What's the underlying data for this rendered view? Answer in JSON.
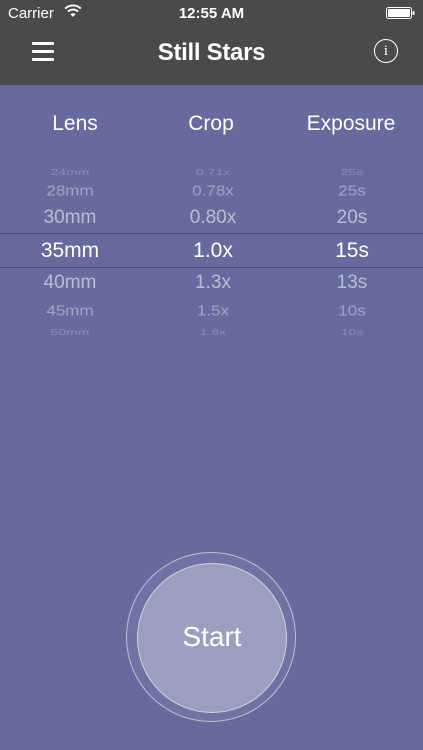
{
  "status_bar": {
    "carrier": "Carrier",
    "time": "12:55 AM",
    "wifi_icon": "wifi-icon",
    "battery_icon": "battery-icon"
  },
  "nav": {
    "title": "Still Stars",
    "menu_icon": "hamburger-menu-icon",
    "info_label": "i"
  },
  "columns": {
    "lens": "Lens",
    "crop": "Crop",
    "exposure": "Exposure"
  },
  "picker": {
    "lens": [
      "24mm",
      "28mm",
      "30mm",
      "35mm",
      "40mm",
      "45mm",
      "50mm"
    ],
    "crop": [
      "0.71x",
      "0.78x",
      "0.80x",
      "1.0x",
      "1.3x",
      "1.5x",
      "1.6x"
    ],
    "exposure": [
      "25s",
      "25s",
      "20s",
      "15s",
      "13s",
      "10s",
      "10s"
    ],
    "selected_index": 3
  },
  "start_button": {
    "label": "Start"
  },
  "colors": {
    "background": "#666b9e",
    "topbar": "#4a4a4a",
    "start_fill": "#9a9fbf"
  }
}
